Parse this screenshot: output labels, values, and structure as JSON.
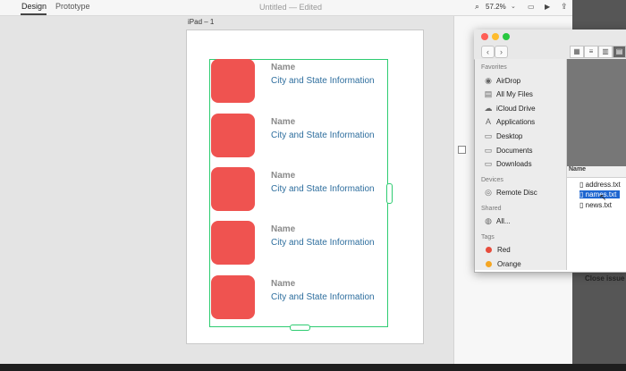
{
  "toolbar": {
    "tabs": [
      "Design",
      "Prototype"
    ],
    "title": "Untitled — Edited",
    "zoom": "57.2%"
  },
  "artboard": {
    "label": "iPad – 1"
  },
  "cells": [
    {
      "name": "Name",
      "city": "City and State Information"
    },
    {
      "name": "Name",
      "city": "City and State Information"
    },
    {
      "name": "Name",
      "city": "City and State Information"
    },
    {
      "name": "Name",
      "city": "City and State Information"
    },
    {
      "name": "Name",
      "city": "City and State Information"
    }
  ],
  "finder": {
    "sections": {
      "favorites": "Favorites",
      "devices": "Devices",
      "shared": "Shared",
      "tags": "Tags"
    },
    "favorites": [
      "AirDrop",
      "All My Files",
      "iCloud Drive",
      "Applications",
      "Desktop",
      "Documents",
      "Downloads"
    ],
    "devices": [
      "Remote Disc"
    ],
    "shared": [
      "All..."
    ],
    "tags": [
      {
        "label": "Red",
        "color": "#e74c3c"
      },
      {
        "label": "Orange",
        "color": "#f5a623"
      }
    ],
    "column_header": "Name",
    "files": [
      "address.txt",
      "names.txt",
      "news.txt"
    ],
    "selected_file": "names.txt"
  },
  "background_label": "Close issue",
  "colors": {
    "thumb": "#ef5350",
    "grid_outline": "#2ecc71",
    "selection": "#1e66d0"
  }
}
